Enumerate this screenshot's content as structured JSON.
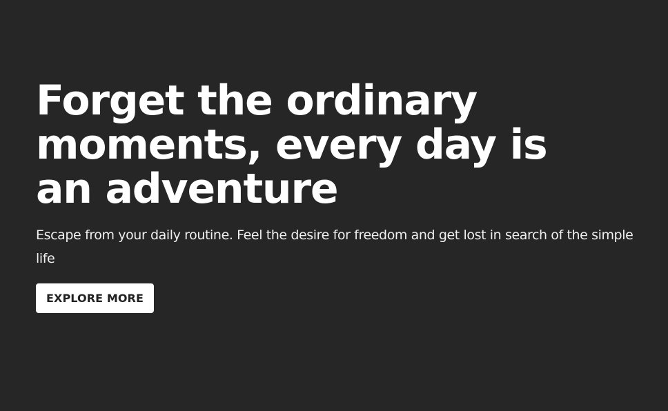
{
  "hero": {
    "title": "Forget the ordinary moments, every day is an adventure",
    "subtitle": "Escape from your daily routine. Feel the desire for freedom and get lost in search of the simple life",
    "cta_label": "EXPLORE MORE"
  },
  "colors": {
    "background": "#262626",
    "text": "#ffffff",
    "button_background": "#ffffff",
    "button_text": "#222222"
  }
}
